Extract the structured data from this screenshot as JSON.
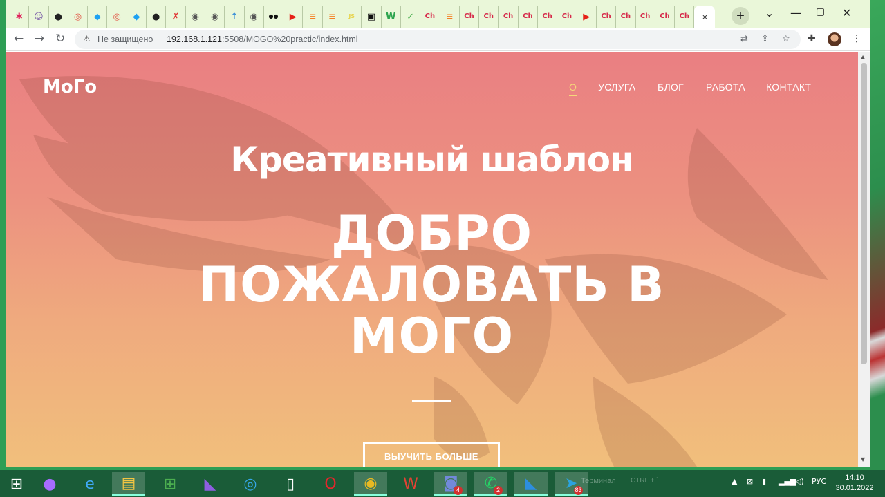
{
  "browser": {
    "tabs": [
      {
        "icon": "slack-icon",
        "glyph": "✱",
        "color": "#e01e5a"
      },
      {
        "icon": "avatar-icon",
        "glyph": "☺",
        "color": "#7b5ea7"
      },
      {
        "icon": "github-icon",
        "glyph": "●",
        "color": "#222"
      },
      {
        "icon": "coursera-icon",
        "glyph": "◎",
        "color": "#e25b4a"
      },
      {
        "icon": "figma-icon",
        "glyph": "◆",
        "color": "#1da1f2"
      },
      {
        "icon": "coursera-icon",
        "glyph": "◎",
        "color": "#e25b4a"
      },
      {
        "icon": "figma-icon",
        "glyph": "◆",
        "color": "#1da1f2"
      },
      {
        "icon": "github-icon",
        "glyph": "●",
        "color": "#222"
      },
      {
        "icon": "person-icon",
        "glyph": "✗",
        "color": "#e03030"
      },
      {
        "icon": "globe-icon",
        "glyph": "◉",
        "color": "#555"
      },
      {
        "icon": "globe-icon",
        "glyph": "◉",
        "color": "#555"
      },
      {
        "icon": "upload-icon",
        "glyph": "↑",
        "color": "#3a8fd8"
      },
      {
        "icon": "globe-icon",
        "glyph": "◉",
        "color": "#555"
      },
      {
        "icon": "dots-icon",
        "glyph": "●●",
        "color": "#111"
      },
      {
        "icon": "youtube-icon",
        "glyph": "▶",
        "color": "#e62117"
      },
      {
        "icon": "stackoverflow-icon",
        "glyph": "≡",
        "color": "#f48024"
      },
      {
        "icon": "stackoverflow-icon",
        "glyph": "≡",
        "color": "#f48024"
      },
      {
        "icon": "js-icon",
        "glyph": "JS",
        "color": "#e8d44d"
      },
      {
        "icon": "terminal-icon",
        "glyph": "▣",
        "color": "#111"
      },
      {
        "icon": "w-icon",
        "glyph": "W",
        "color": "#2ea44f"
      },
      {
        "icon": "check-icon",
        "glyph": "✓",
        "color": "#4caf50"
      },
      {
        "icon": "ch-icon",
        "glyph": "Ch",
        "color": "ch"
      },
      {
        "icon": "stackoverflow-icon",
        "glyph": "≡",
        "color": "#f48024"
      },
      {
        "icon": "ch-icon",
        "glyph": "Ch",
        "color": "ch"
      },
      {
        "icon": "ch-icon",
        "glyph": "Ch",
        "color": "ch"
      },
      {
        "icon": "ch-icon",
        "glyph": "Ch",
        "color": "ch"
      },
      {
        "icon": "ch-icon",
        "glyph": "Ch",
        "color": "ch"
      },
      {
        "icon": "ch-icon",
        "glyph": "Ch",
        "color": "ch"
      },
      {
        "icon": "ch-icon",
        "glyph": "Ch",
        "color": "ch"
      },
      {
        "icon": "youtube-icon",
        "glyph": "▶",
        "color": "#e62117"
      },
      {
        "icon": "ch-icon",
        "glyph": "Ch",
        "color": "ch"
      },
      {
        "icon": "ch-icon",
        "glyph": "Ch",
        "color": "ch"
      },
      {
        "icon": "ch-icon",
        "glyph": "Ch",
        "color": "ch"
      },
      {
        "icon": "ch-icon",
        "glyph": "Ch",
        "color": "ch"
      },
      {
        "icon": "ch-icon",
        "glyph": "Ch",
        "color": "ch"
      }
    ],
    "active_tab_close": "×",
    "new_tab": "+",
    "window_controls": [
      "⌄",
      "—",
      "▢",
      "✕"
    ],
    "security_label": "Не защищено",
    "url_host": "192.168.1.121",
    "url_rest": ":5508/MOGO%20practic/index.html"
  },
  "page": {
    "logo": "MoГo",
    "nav": [
      "О",
      "УСЛУГА",
      "БЛОГ",
      "РАБОТА",
      "КОНТАКТ"
    ],
    "subtitle": "Креативный шаблон",
    "headline": [
      "ДОБРО",
      "ПОЖАЛОВАТЬ В",
      "МОГО"
    ],
    "cta": "ВЫУЧИТЬ БОЛЬШЕ",
    "accent_color": "#f5d87a"
  },
  "taskbar": {
    "apps": [
      {
        "icon": "start-icon"
      },
      {
        "icon": "alice-icon"
      },
      {
        "icon": "internet-explorer-icon"
      },
      {
        "icon": "file-explorer-icon"
      },
      {
        "icon": "store-icon"
      },
      {
        "icon": "visual-studio-icon"
      },
      {
        "icon": "edge-icon"
      },
      {
        "icon": "document-icon"
      },
      {
        "icon": "opera-icon"
      },
      {
        "icon": "chrome-icon"
      },
      {
        "icon": "wps-icon"
      },
      {
        "icon": "discord-icon",
        "badge": "4"
      },
      {
        "icon": "whatsapp-icon",
        "badge": "2"
      },
      {
        "icon": "vscode-icon"
      },
      {
        "icon": "telegram-icon",
        "badge": "83"
      }
    ],
    "faded_text": "Терминал",
    "faded_shortcut": "CTRL + `",
    "language": "РУС",
    "time": "14:10",
    "date": "30.01.2022"
  }
}
